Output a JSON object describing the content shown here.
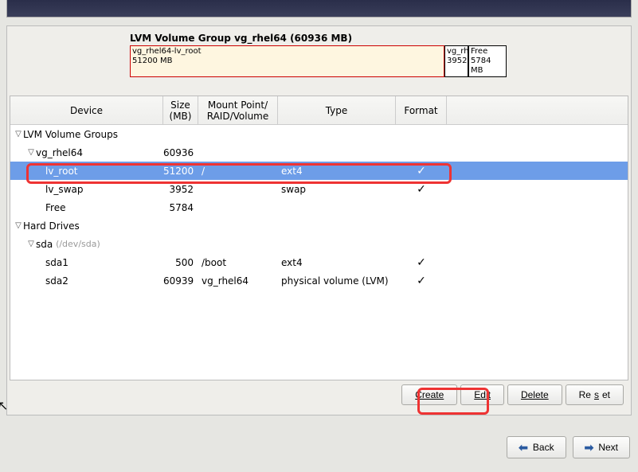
{
  "vg": {
    "title": "LVM Volume Group vg_rhel64 (60936 MB)",
    "main_name": "vg_rhel64-lv_root",
    "main_size": "51200 MB",
    "small_name": "vg_rh",
    "small_size": "3952",
    "free_name": "Free",
    "free_size": "5784 MB"
  },
  "headers": {
    "device": "Device",
    "size": "Size (MB)",
    "mount": "Mount Point/ RAID/Volume",
    "type": "Type",
    "format": "Format"
  },
  "rows": {
    "lvm_groups": "LVM Volume Groups",
    "vg_name": "vg_rhel64",
    "vg_size": "60936",
    "lv_root": "lv_root",
    "lv_root_size": "51200",
    "lv_root_mount": "/",
    "lv_root_type": "ext4",
    "lv_root_fmt": "✓",
    "lv_swap": "lv_swap",
    "lv_swap_size": "3952",
    "lv_swap_type": "swap",
    "lv_swap_fmt": "✓",
    "free": "Free",
    "free_size": "5784",
    "hard_drives": "Hard Drives",
    "sda": "sda",
    "sda_path": "(/dev/sda)",
    "sda1": "sda1",
    "sda1_size": "500",
    "sda1_mount": "/boot",
    "sda1_type": "ext4",
    "sda1_fmt": "✓",
    "sda2": "sda2",
    "sda2_size": "60939",
    "sda2_mount": "vg_rhel64",
    "sda2_type": "physical volume (LVM)",
    "sda2_fmt": "✓"
  },
  "buttons": {
    "create": "Create",
    "edit": "Edit",
    "delete": "Delete",
    "reset": "Reset",
    "back": "Back",
    "next": "Next"
  }
}
